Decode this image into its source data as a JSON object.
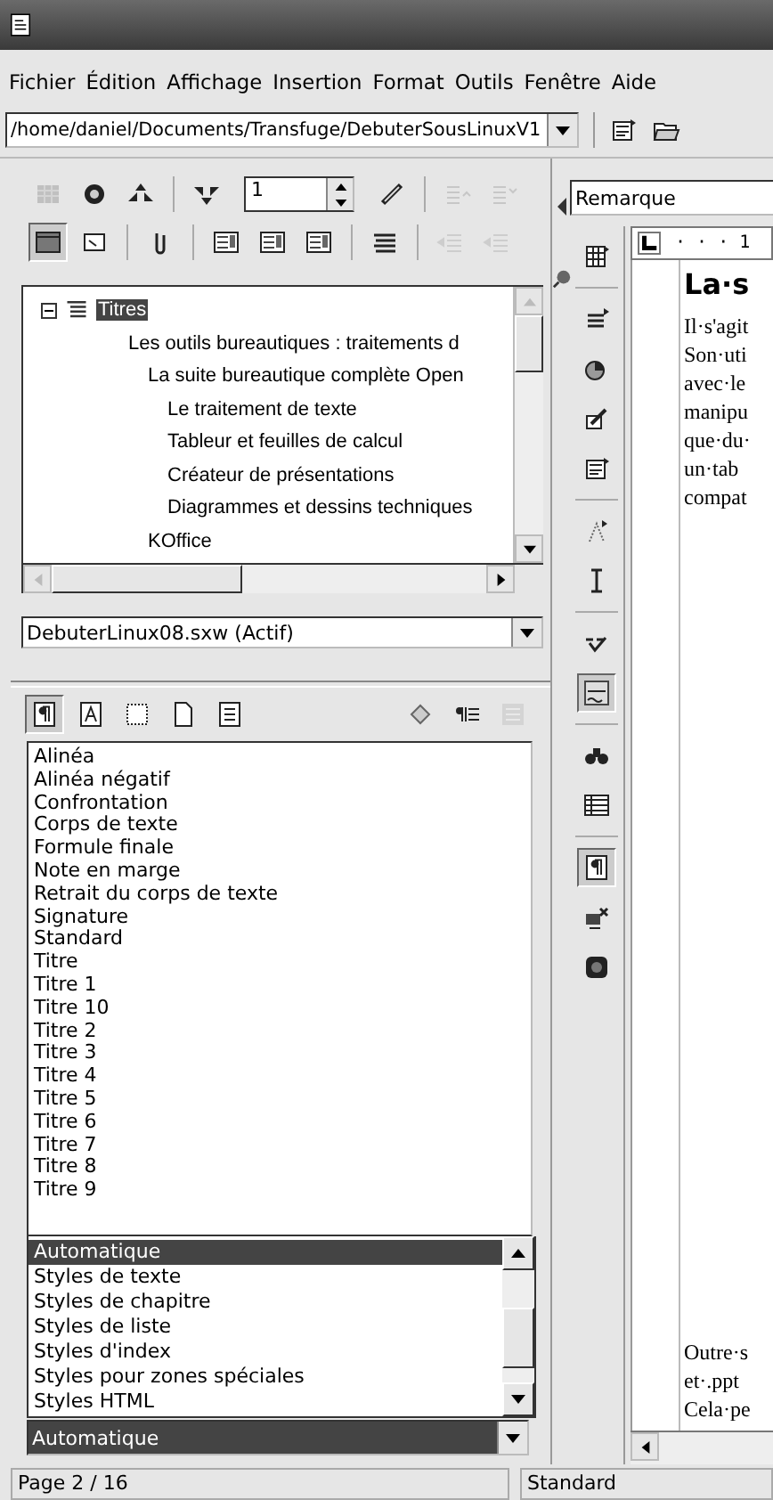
{
  "menu": [
    "Fichier",
    "Édition",
    "Affichage",
    "Insertion",
    "Format",
    "Outils",
    "Fenêtre",
    "Aide"
  ],
  "url_field": {
    "value": "/home/daniel/Documents/Transfuge/DebuterSousLinuxV1"
  },
  "navigator": {
    "page_number": "1",
    "row_1": [
      {
        "pressed": false,
        "disabled": true
      },
      {
        "pressed": false,
        "disabled": false
      },
      {
        "pressed": false,
        "disabled": false
      },
      {
        "pressed": false,
        "disabled": false
      },
      {
        "pressed": false,
        "disabled": false
      },
      {
        "pressed": false,
        "disabled": true
      },
      {
        "pressed": false,
        "disabled": true
      }
    ],
    "row_2": [
      {
        "pressed": true,
        "disabled": false
      },
      {
        "pressed": false,
        "disabled": false
      },
      {
        "pressed": false,
        "disabled": false
      },
      {
        "pressed": false,
        "disabled": false
      },
      {
        "pressed": false,
        "disabled": false
      },
      {
        "pressed": false,
        "disabled": false
      },
      {
        "pressed": false,
        "disabled": false
      },
      {
        "pressed": false,
        "disabled": true
      },
      {
        "pressed": false,
        "disabled": true
      }
    ],
    "tree": [
      {
        "label": "Titres",
        "expanded": true,
        "selected": true,
        "children": [
          {
            "label": "Les outils bureautiques  : traitements d",
            "selected": false,
            "children": [
              {
                "label": "La suite bureautique complète Open",
                "selected": false,
                "children": [
                  {
                    "label": "Le traitement de texte",
                    "selected": false
                  },
                  {
                    "label": "Tableur et feuilles de calcul",
                    "selected": false
                  },
                  {
                    "label": "Créateur de présentations",
                    "selected": false
                  },
                  {
                    "label": "Diagrammes et dessins techniques",
                    "selected": false
                  }
                ]
              },
              {
                "label": "KOffice",
                "selected": false
              }
            ]
          }
        ]
      }
    ],
    "document_select": "DebuterLinux08.sxw (Actif)"
  },
  "stylist": {
    "families": [
      {
        "selected": true
      },
      {
        "selected": false
      },
      {
        "selected": false
      },
      {
        "selected": false
      },
      {
        "selected": false
      }
    ],
    "actions": [
      {
        "disabled": false
      },
      {
        "disabled": false
      },
      {
        "disabled": true
      }
    ],
    "styles": [
      "Alinéa",
      "Alinéa négatif",
      "Confrontation",
      "Corps de texte",
      "Formule finale",
      "Note en marge",
      "Retrait du corps de texte",
      "Signature",
      "Standard",
      "Titre",
      "Titre 1",
      "Titre 10",
      "Titre 2",
      "Titre 3",
      "Titre 4",
      "Titre 5",
      "Titre 6",
      "Titre 7",
      "Titre 8",
      "Titre 9"
    ],
    "filter_options": [
      {
        "label": "Automatique",
        "selected": true
      },
      {
        "label": "Styles de texte",
        "selected": false
      },
      {
        "label": "Styles de chapitre",
        "selected": false
      },
      {
        "label": "Styles de liste",
        "selected": false
      },
      {
        "label": "Styles d'index",
        "selected": false
      },
      {
        "label": "Styles pour zones spéciales",
        "selected": false
      },
      {
        "label": "Styles HTML",
        "selected": false
      }
    ],
    "filter_value": "Automatique"
  },
  "paragraph_style": "Remarque",
  "side_toolbar": [
    {
      "pressed": false
    },
    {
      "pressed": false
    },
    {
      "pressed": false
    },
    {
      "pressed": false
    },
    {
      "pressed": false
    },
    {
      "pressed": false
    },
    {
      "pressed": false
    },
    {
      "pressed": false
    },
    {
      "pressed": true
    },
    {
      "pressed": false
    },
    {
      "pressed": false
    },
    {
      "pressed": true
    },
    {
      "pressed": false
    },
    {
      "pressed": false
    }
  ],
  "ruler": "· · · 1",
  "document": {
    "heading": "La·s",
    "lines": [
      "Il·s'agit",
      "Son·uti",
      "avec·le",
      "manipu",
      "que·du·",
      "un·tab",
      "compat"
    ],
    "bottom_lines": [
      "Outre·s",
      "et·.ppt",
      "Cela·pe"
    ]
  },
  "status_bar": [
    "Page 2 / 16",
    "Standard"
  ]
}
